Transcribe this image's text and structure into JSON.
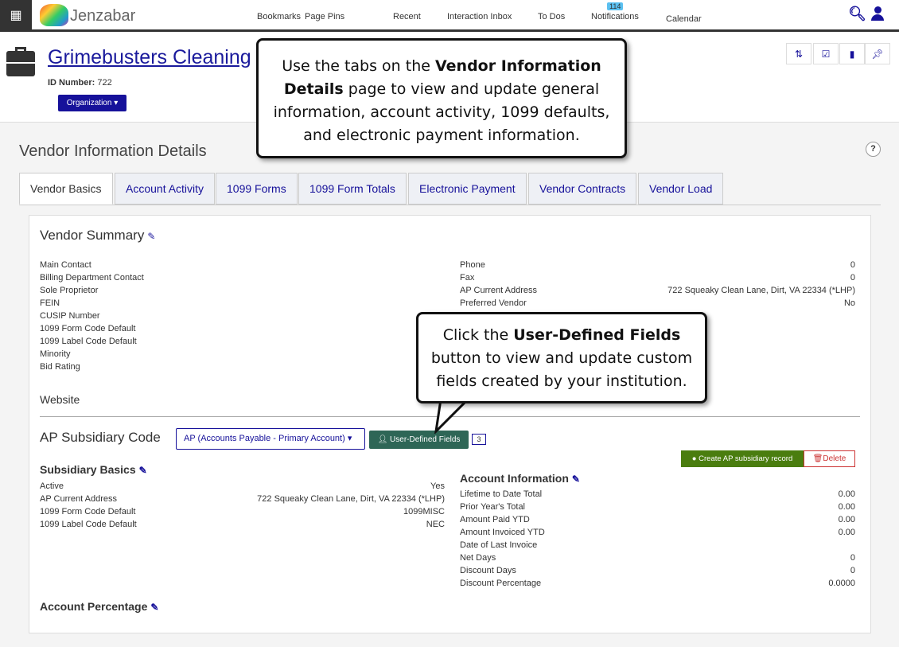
{
  "topnav": {
    "logo": "Jenzabar",
    "items": [
      "Bookmarks",
      "Page Pins",
      "Recent",
      "Interaction Inbox",
      "To Dos",
      "Notifications",
      "Calendar"
    ],
    "notifications_count": "114"
  },
  "header": {
    "title": "Grimebusters Cleaning",
    "id_label": "ID Number:",
    "id_value": "722",
    "org_button": "Organization"
  },
  "page": {
    "title": "Vendor Information Details",
    "help": "?"
  },
  "tabs": [
    "Vendor Basics",
    "Account Activity",
    "1099 Forms",
    "1099 Form Totals",
    "Electronic Payment",
    "Vendor Contracts",
    "Vendor Load"
  ],
  "summary": {
    "title": "Vendor Summary",
    "left": [
      "Main Contact",
      "Billing Department Contact",
      "Sole Proprietor",
      "FEIN",
      "CUSIP Number",
      "1099 Form Code Default",
      "1099 Label Code Default",
      "Minority",
      "Bid Rating"
    ],
    "right": [
      {
        "label": "Phone",
        "value": "0"
      },
      {
        "label": "Fax",
        "value": "0"
      },
      {
        "label": "AP Current Address",
        "value": "722 Squeaky Clean Lane, Dirt, VA 22334 (*LHP)"
      },
      {
        "label": "Preferred Vendor",
        "value": "No"
      }
    ],
    "website": "Website"
  },
  "subsidiary": {
    "title": "AP Subsidiary Code",
    "select": "AP (Accounts Payable - Primary Account)",
    "udf_button": "User-Defined Fields",
    "udf_count": "3",
    "create_button": "Create AP subsidiary record",
    "delete_button": "Delete"
  },
  "basics": {
    "title": "Subsidiary Basics",
    "rows": [
      {
        "label": "Active",
        "value": "Yes"
      },
      {
        "label": "AP Current Address",
        "value": "722 Squeaky Clean Lane, Dirt, VA 22334 (*LHP)"
      },
      {
        "label": "1099 Form Code Default",
        "value": "1099MISC"
      },
      {
        "label": "1099 Label Code Default",
        "value": "NEC"
      }
    ]
  },
  "account": {
    "title": "Account Information",
    "rows": [
      {
        "label": "Lifetime to Date Total",
        "value": "0.00"
      },
      {
        "label": "Prior Year's Total",
        "value": "0.00"
      },
      {
        "label": "Amount Paid YTD",
        "value": "0.00"
      },
      {
        "label": "Amount Invoiced YTD",
        "value": "0.00"
      },
      {
        "label": "Date of Last Invoice",
        "value": ""
      },
      {
        "label": "Net Days",
        "value": "0"
      },
      {
        "label": "Discount Days",
        "value": "0"
      },
      {
        "label": "Discount Percentage",
        "value": "0.0000"
      }
    ]
  },
  "percentage": {
    "title": "Account Percentage"
  },
  "callouts": {
    "tabs": {
      "pre": "Use the tabs on the ",
      "bold": "Vendor Information Details",
      "post": " page to view and update general information, account activity, 1099 defaults, and electronic payment information."
    },
    "udf": {
      "pre": "Click the ",
      "bold": "User-Defined Fields",
      "post": " button to view and update custom fields created by your institution."
    }
  }
}
